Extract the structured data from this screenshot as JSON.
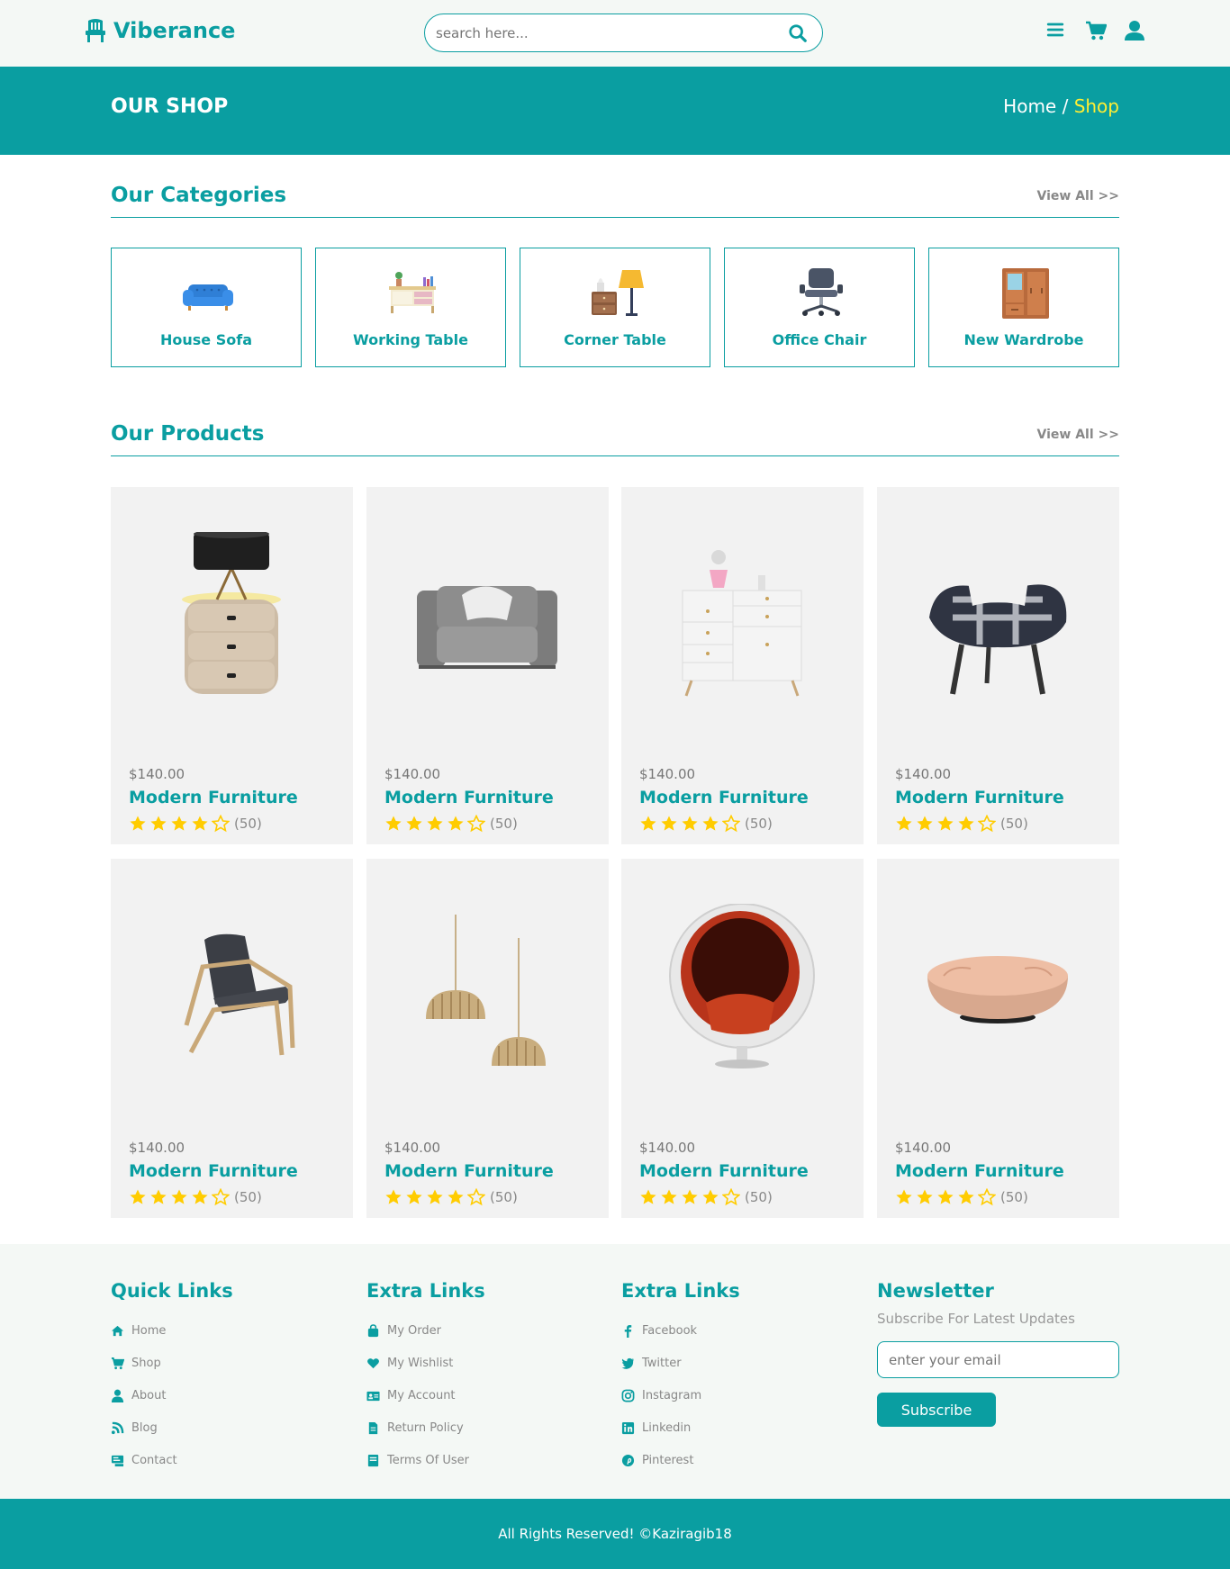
{
  "brand": {
    "name": "Viberance"
  },
  "search": {
    "placeholder": "search here..."
  },
  "header_icons": [
    "menu-icon",
    "cart-icon",
    "user-icon"
  ],
  "hero": {
    "title": "OUR SHOP",
    "breadcrumb": {
      "home": "Home",
      "separator": " / ",
      "current": "Shop"
    }
  },
  "categories": {
    "title": "Our Categories",
    "view_all": "View All >>",
    "items": [
      {
        "label": "House Sofa",
        "icon": "sofa-icon"
      },
      {
        "label": "Working Table",
        "icon": "working-table-icon"
      },
      {
        "label": "Corner Table",
        "icon": "corner-table-icon"
      },
      {
        "label": "Office Chair",
        "icon": "office-chair-icon"
      },
      {
        "label": "New Wardrobe",
        "icon": "wardrobe-icon"
      }
    ]
  },
  "products": {
    "title": "Our Products",
    "view_all": "View All >>",
    "items": [
      {
        "price": "$140.00",
        "name": "Modern Furniture",
        "rating": 4,
        "reviews": "(50)",
        "image": "lamp-nightstand"
      },
      {
        "price": "$140.00",
        "name": "Modern Furniture",
        "rating": 4,
        "reviews": "(50)",
        "image": "grey-armchair"
      },
      {
        "price": "$140.00",
        "name": "Modern Furniture",
        "rating": 4,
        "reviews": "(50)",
        "image": "white-dresser"
      },
      {
        "price": "$140.00",
        "name": "Modern Furniture",
        "rating": 4,
        "reviews": "(50)",
        "image": "plaid-chair"
      },
      {
        "price": "$140.00",
        "name": "Modern Furniture",
        "rating": 4,
        "reviews": "(50)",
        "image": "wood-lounge-chair"
      },
      {
        "price": "$140.00",
        "name": "Modern Furniture",
        "rating": 4,
        "reviews": "(50)",
        "image": "pendant-lamps"
      },
      {
        "price": "$140.00",
        "name": "Modern Furniture",
        "rating": 4,
        "reviews": "(50)",
        "image": "ball-chair"
      },
      {
        "price": "$140.00",
        "name": "Modern Furniture",
        "rating": 4,
        "reviews": "(50)",
        "image": "pouf-ottoman"
      }
    ]
  },
  "footer": {
    "quick_links": {
      "title": "Quick Links",
      "items": [
        {
          "label": "Home",
          "icon": "home-icon"
        },
        {
          "label": "Shop",
          "icon": "cart-icon"
        },
        {
          "label": "About",
          "icon": "user-icon"
        },
        {
          "label": "Blog",
          "icon": "blog-icon"
        },
        {
          "label": "Contact",
          "icon": "contact-icon"
        }
      ]
    },
    "extra_links_1": {
      "title": "Extra Links",
      "items": [
        {
          "label": "My Order",
          "icon": "bag-icon"
        },
        {
          "label": "My Wishlist",
          "icon": "heart-icon"
        },
        {
          "label": "My Account",
          "icon": "id-card-icon"
        },
        {
          "label": "Return Policy",
          "icon": "file-icon"
        },
        {
          "label": "Terms Of User",
          "icon": "book-icon"
        }
      ]
    },
    "extra_links_2": {
      "title": "Extra Links",
      "items": [
        {
          "label": "Facebook",
          "icon": "facebook-icon"
        },
        {
          "label": "Twitter",
          "icon": "twitter-icon"
        },
        {
          "label": "Instagram",
          "icon": "instagram-icon"
        },
        {
          "label": "Linkedin",
          "icon": "linkedin-icon"
        },
        {
          "label": "Pinterest",
          "icon": "pinterest-icon"
        }
      ]
    },
    "newsletter": {
      "title": "Newsletter",
      "subtitle": "Subscribe For Latest Updates",
      "placeholder": "enter your email",
      "button": "Subscribe"
    }
  },
  "copyright": "All Rights Reserved! ©Kaziragib18",
  "colors": {
    "accent": "#0a9ea1",
    "highlight": "#ffee33",
    "star": "#ffcc00",
    "card_bg": "#f2f2f2"
  }
}
